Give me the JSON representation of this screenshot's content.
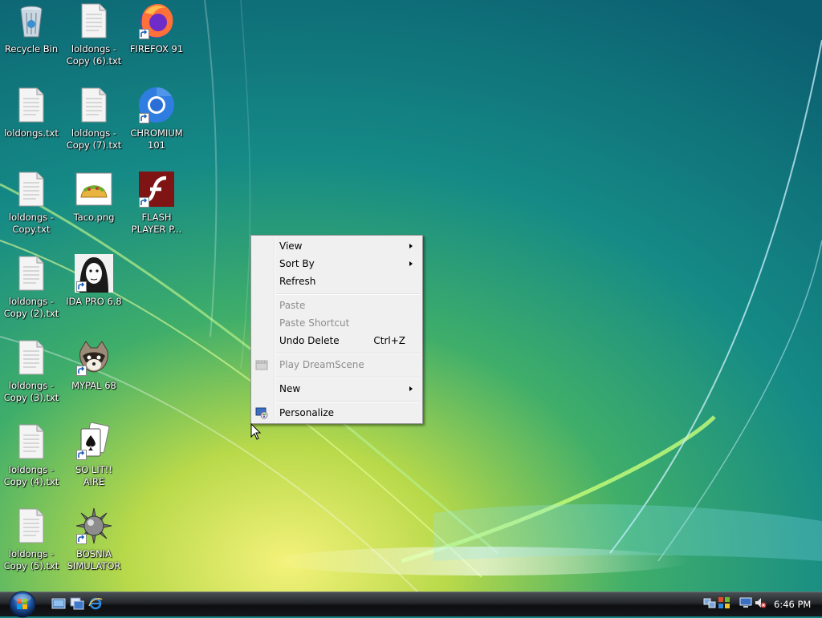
{
  "desktop": {
    "icons": [
      {
        "label": "Recycle Bin"
      },
      {
        "label": "loldongs - Copy (6).txt"
      },
      {
        "label": "FIREFOX 91"
      },
      {
        "label": "loldongs.txt"
      },
      {
        "label": "loldongs - Copy (7).txt"
      },
      {
        "label": "CHROMIUM 101"
      },
      {
        "label": "loldongs - Copy.txt"
      },
      {
        "label": "Taco.png"
      },
      {
        "label": "FLASH PLAYER P..."
      },
      {
        "label": "loldongs - Copy (2).txt"
      },
      {
        "label": "IDA PRO 6.8"
      },
      {
        "label": "loldongs - Copy (3).txt"
      },
      {
        "label": "MYPAL 68"
      },
      {
        "label": "loldongs - Copy (4).txt"
      },
      {
        "label": "SO LIT!! AIRE"
      },
      {
        "label": "loldongs - Copy (5).txt"
      },
      {
        "label": "BOSNIA SIMULATOR"
      }
    ]
  },
  "context_menu": {
    "view": "View",
    "sort_by": "Sort By",
    "refresh": "Refresh",
    "paste": "Paste",
    "paste_shortcut": "Paste Shortcut",
    "undo_delete": "Undo Delete",
    "undo_shortcut": "Ctrl+Z",
    "play_dreamscene": "Play DreamScene",
    "new": "New",
    "personalize": "Personalize"
  },
  "taskbar": {
    "clock": "6:46 PM",
    "quick_launch": [
      "show-desktop-icon",
      "switch-windows-icon",
      "internet-explorer-icon"
    ],
    "tray": [
      "network-icon",
      "security-icon",
      "volume-muted-icon"
    ]
  },
  "colors": {
    "wallpaper_base": "#14807f",
    "menu_bg": "#f0f0f0",
    "disabled_text": "#8d8d8d"
  }
}
